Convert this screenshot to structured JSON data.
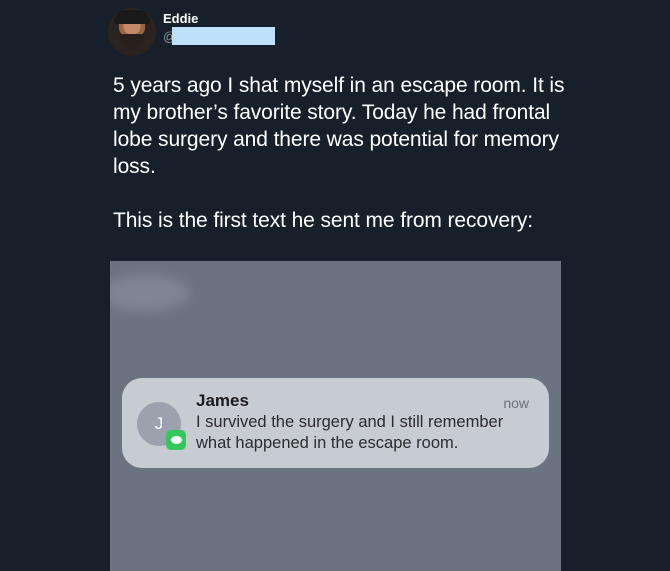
{
  "tweet": {
    "display_name": "Eddie",
    "handle_prefix": "@",
    "text_paragraph_1": "5 years ago I shat myself in an escape room. It is my brother’s favorite story. Today he had frontal lobe surgery and there was potential for memory loss.",
    "text_paragraph_2": "This is the first text he sent me from recovery:"
  },
  "notification": {
    "avatar_initial": "J",
    "app_icon": "messages-icon",
    "sender": "James",
    "time": "now",
    "message": "I survived the surgery and I still remember what happened in the escape room."
  },
  "colors": {
    "background": "#17202a",
    "redaction": "#bfe0fb",
    "media_background": "#6b7280",
    "notification_background": "#c7cbd2",
    "messages_green": "#34c759"
  }
}
